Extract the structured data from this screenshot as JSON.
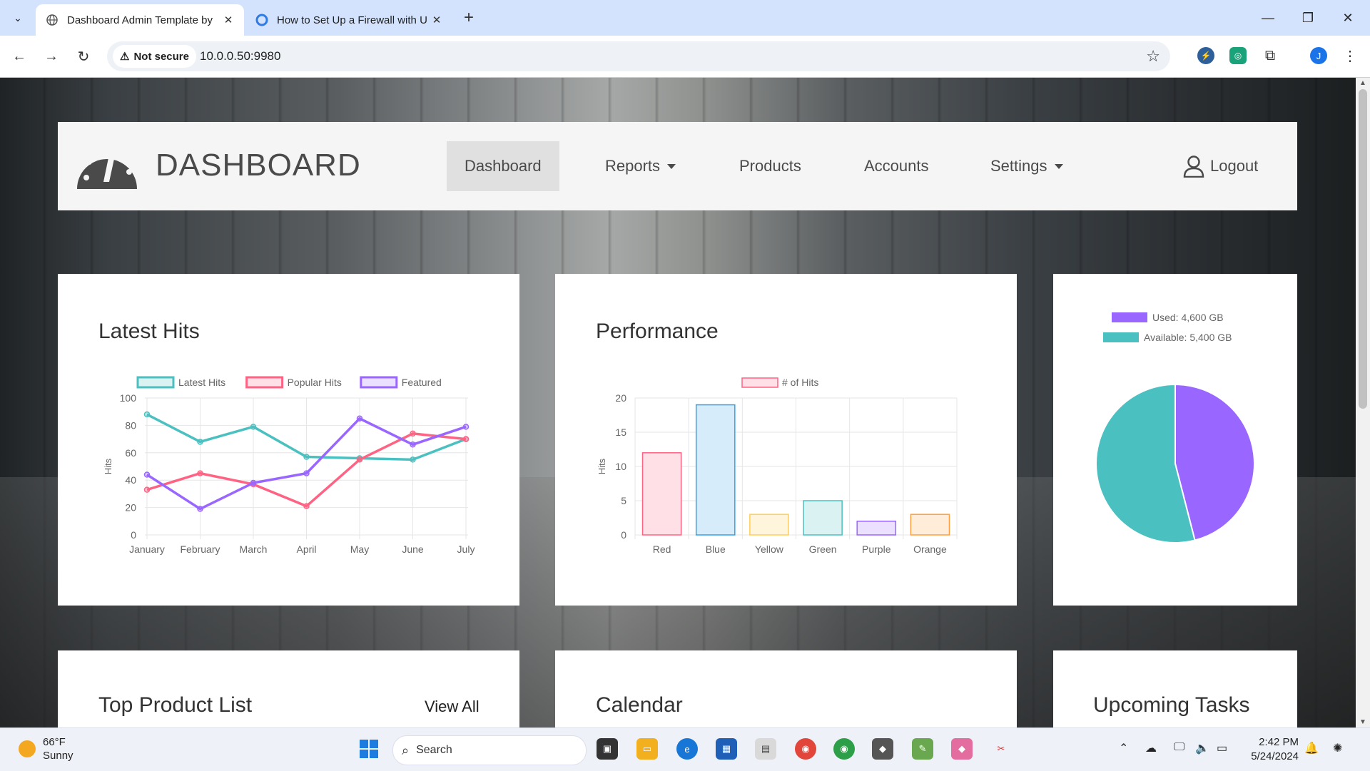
{
  "browser": {
    "tabs": [
      {
        "title": "Dashboard Admin Template by",
        "active": true
      },
      {
        "title": "How to Set Up a Firewall with U",
        "active": false
      }
    ],
    "not_secure_label": "Not secure",
    "url": "10.0.0.50:9980",
    "profile_initial": "J"
  },
  "header": {
    "brand": "DASHBOARD",
    "nav": [
      {
        "label": "Dashboard",
        "active": true,
        "dropdown": false
      },
      {
        "label": "Reports",
        "active": false,
        "dropdown": true
      },
      {
        "label": "Products",
        "active": false,
        "dropdown": false
      },
      {
        "label": "Accounts",
        "active": false,
        "dropdown": false
      },
      {
        "label": "Settings",
        "active": false,
        "dropdown": true
      }
    ],
    "logout_label": "Logout"
  },
  "cards": {
    "latest_hits_title": "Latest Hits",
    "performance_title": "Performance",
    "top_products_title": "Top Product List",
    "view_all_label": "View All",
    "calendar_title": "Calendar",
    "tasks_title": "Upcoming Tasks"
  },
  "chart_data": [
    {
      "type": "line",
      "title": "Latest Hits",
      "ylabel": "Hits",
      "ylim": [
        0,
        100
      ],
      "yticks": [
        0,
        20,
        40,
        60,
        80,
        100
      ],
      "categories": [
        "January",
        "February",
        "March",
        "April",
        "May",
        "June",
        "July"
      ],
      "series": [
        {
          "name": "Latest Hits",
          "color": "#4bc0c0",
          "values": [
            88,
            68,
            79,
            57,
            56,
            55,
            70
          ]
        },
        {
          "name": "Popular Hits",
          "color": "#ff6384",
          "values": [
            33,
            45,
            37,
            21,
            55,
            74,
            70
          ]
        },
        {
          "name": "Featured",
          "color": "#9966ff",
          "values": [
            44,
            19,
            38,
            45,
            85,
            66,
            79
          ]
        }
      ],
      "legend": "top",
      "grid": true
    },
    {
      "type": "bar",
      "title": "Performance",
      "ylabel": "Hits",
      "ylim": [
        0,
        20
      ],
      "yticks": [
        0,
        5,
        10,
        15,
        20
      ],
      "categories": [
        "Red",
        "Blue",
        "Yellow",
        "Green",
        "Purple",
        "Orange"
      ],
      "series": [
        {
          "name": "# of Hits",
          "values": [
            12,
            19,
            3,
            5,
            2,
            3
          ]
        }
      ],
      "colors": {
        "fill": [
          "#ffe0e6",
          "#d7ecfb",
          "#fff5dd",
          "#dbf2f2",
          "#ebe0ff",
          "#ffecd9"
        ],
        "stroke": [
          "#ff6384",
          "#36a2eb",
          "#ffce56",
          "#4bc0c0",
          "#9966ff",
          "#ff9f40"
        ]
      },
      "legend": "top",
      "grid": true
    },
    {
      "type": "pie",
      "labels": [
        "Used: 4,600 GB",
        "Available: 5,400 GB"
      ],
      "values": [
        4600,
        5400
      ],
      "colors": [
        "#9966ff",
        "#4bc0c0"
      ],
      "legend": "top"
    }
  ],
  "taskbar": {
    "temp": "66°F",
    "condition": "Sunny",
    "search_label": "Search",
    "time": "2:42 PM",
    "date": "5/24/2024"
  }
}
